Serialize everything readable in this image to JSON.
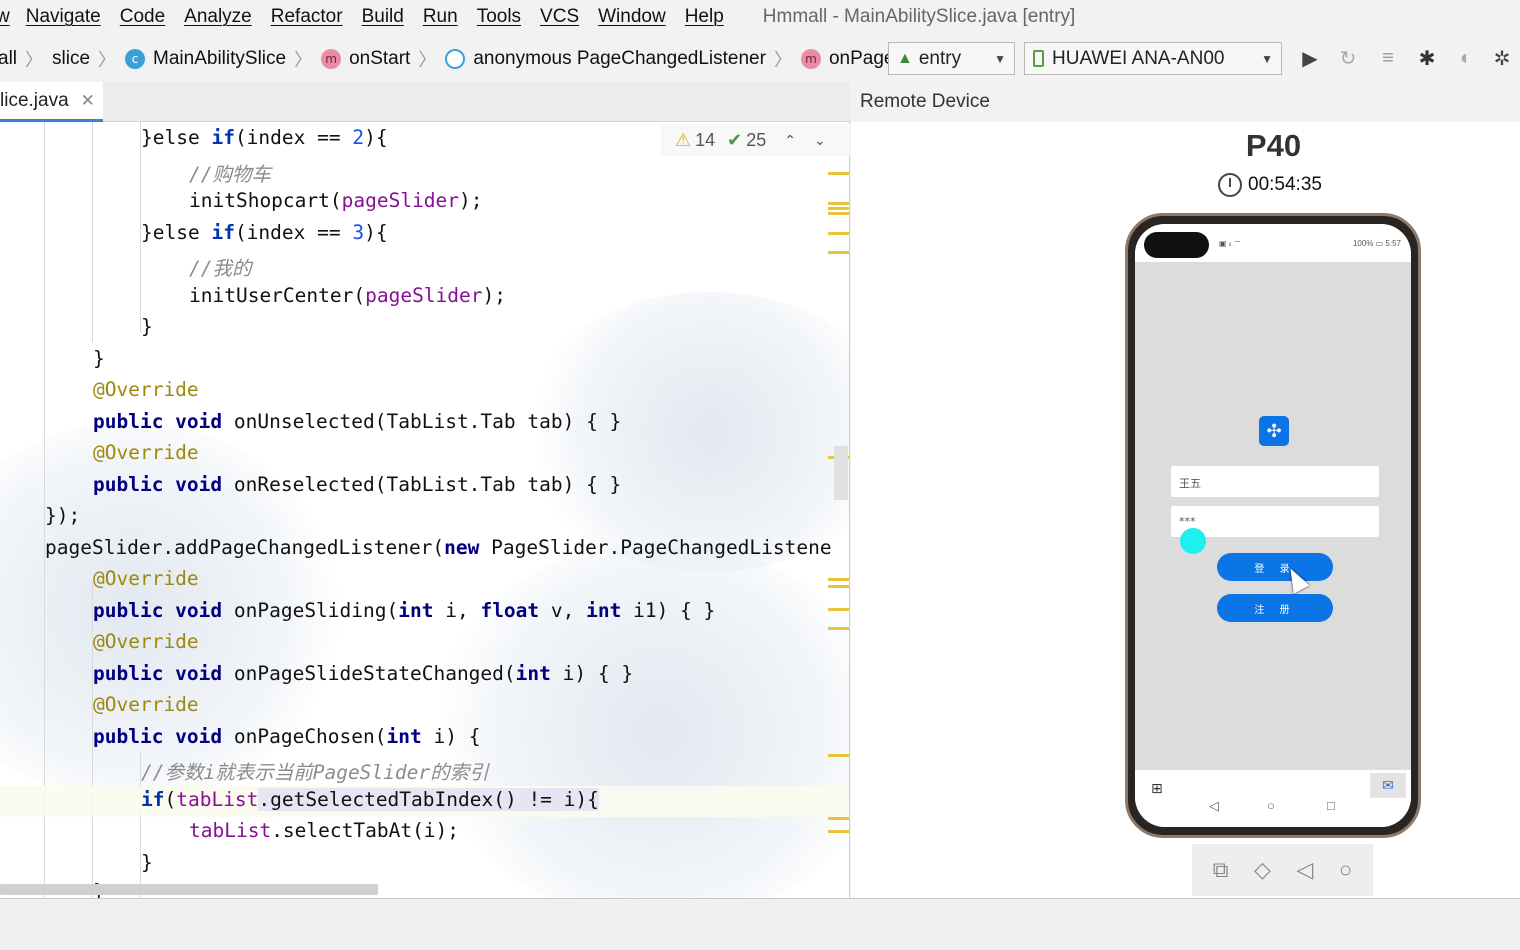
{
  "menu": {
    "first": "w",
    "items": [
      "Navigate",
      "Code",
      "Analyze",
      "Refactor",
      "Build",
      "Run",
      "Tools",
      "VCS",
      "Window",
      "Help"
    ],
    "title": "Hmmall - MainAbilitySlice.java [entry]"
  },
  "breadcrumbs": {
    "c0": "all",
    "c1": "slice",
    "c2": "MainAbilitySlice",
    "c3": "onStart",
    "c4": "anonymous PageChangedListener",
    "c5": "onPageCho",
    "badge_class": "c",
    "badge_method": "m"
  },
  "toolbar": {
    "config": "entry",
    "device": "HUAWEI ANA-AN00",
    "icons": [
      "run-icon",
      "rerun-icon",
      "build-icon",
      "debug-icon",
      "profile-icon",
      "attach-debugger-icon"
    ]
  },
  "editor": {
    "tab": "lice.java",
    "tab_close": "✕",
    "warnings": "14",
    "checks": "25",
    "lines": {
      "l1a": "}else ",
      "l1b": "if",
      "l1c": "(index == ",
      "l1d": "2",
      "l1e": "){",
      "l2": "//购物车",
      "l3a": "initShopcart(",
      "l3b": "pageSlider",
      "l3c": ");",
      "l4a": "}else ",
      "l4b": "if",
      "l4c": "(index == ",
      "l4d": "3",
      "l4e": "){",
      "l5": "//我的",
      "l6a": "initUserCenter(",
      "l6b": "pageSlider",
      "l6c": ");",
      "l7": "}",
      "l8": "}",
      "l9": "@Override",
      "l10a": "public void",
      "l10b": " onUnselected(TabList.Tab tab) { }",
      "l11": "@Override",
      "l12a": "public void",
      "l12b": " onReselected(TabList.Tab tab) { }",
      "l13": "});",
      "l14a": "pageSlider.addPageChangedListener(",
      "l14b": "new",
      "l14c": " PageSlider.PageChangedListene",
      "l15": "@Override",
      "l16a": "public void",
      "l16b": " onPageSliding(",
      "l16c": "int",
      "l16d": " i, ",
      "l16e": "float",
      "l16f": " v, ",
      "l16g": "int",
      "l16h": " i1) { }",
      "l17": "@Override",
      "l18a": "public void",
      "l18b": " onPageSlideStateChanged(",
      "l18c": "int",
      "l18d": " i) { }",
      "l19": "@Override",
      "l20a": "public void",
      "l20b": " onPageChosen(",
      "l20c": "int",
      "l20d": " i) {",
      "l21": "//参数i就表示当前PageSlider的索引",
      "l22a": "if",
      "l22b": "(",
      "l22c": "tabList",
      "l22d": ".getSelectedTabIndex() != i){",
      "l23a": "tabList",
      "l23b": ".selectTabAt(i);",
      "l24": "}",
      "l25": "}"
    }
  },
  "remote": {
    "header": "Remote Device",
    "device_name": "P40",
    "timer": "00:54:35",
    "statusbar_left": "▣ ᵢₗ ⌔",
    "statusbar_right": "100% ▭ 5:57",
    "app": {
      "username": "王五",
      "password": "***",
      "login": "登 录",
      "register": "注 册"
    },
    "sysnav": {
      "back": "◁",
      "home": "○",
      "recent": "□"
    }
  },
  "colors": {
    "accent": "#3d7fd6",
    "keyword": "#0033b3",
    "annotation": "#9e880d",
    "field": "#871094",
    "phone_button": "#0b75e6",
    "touch_dot": "#1ef0ee"
  }
}
